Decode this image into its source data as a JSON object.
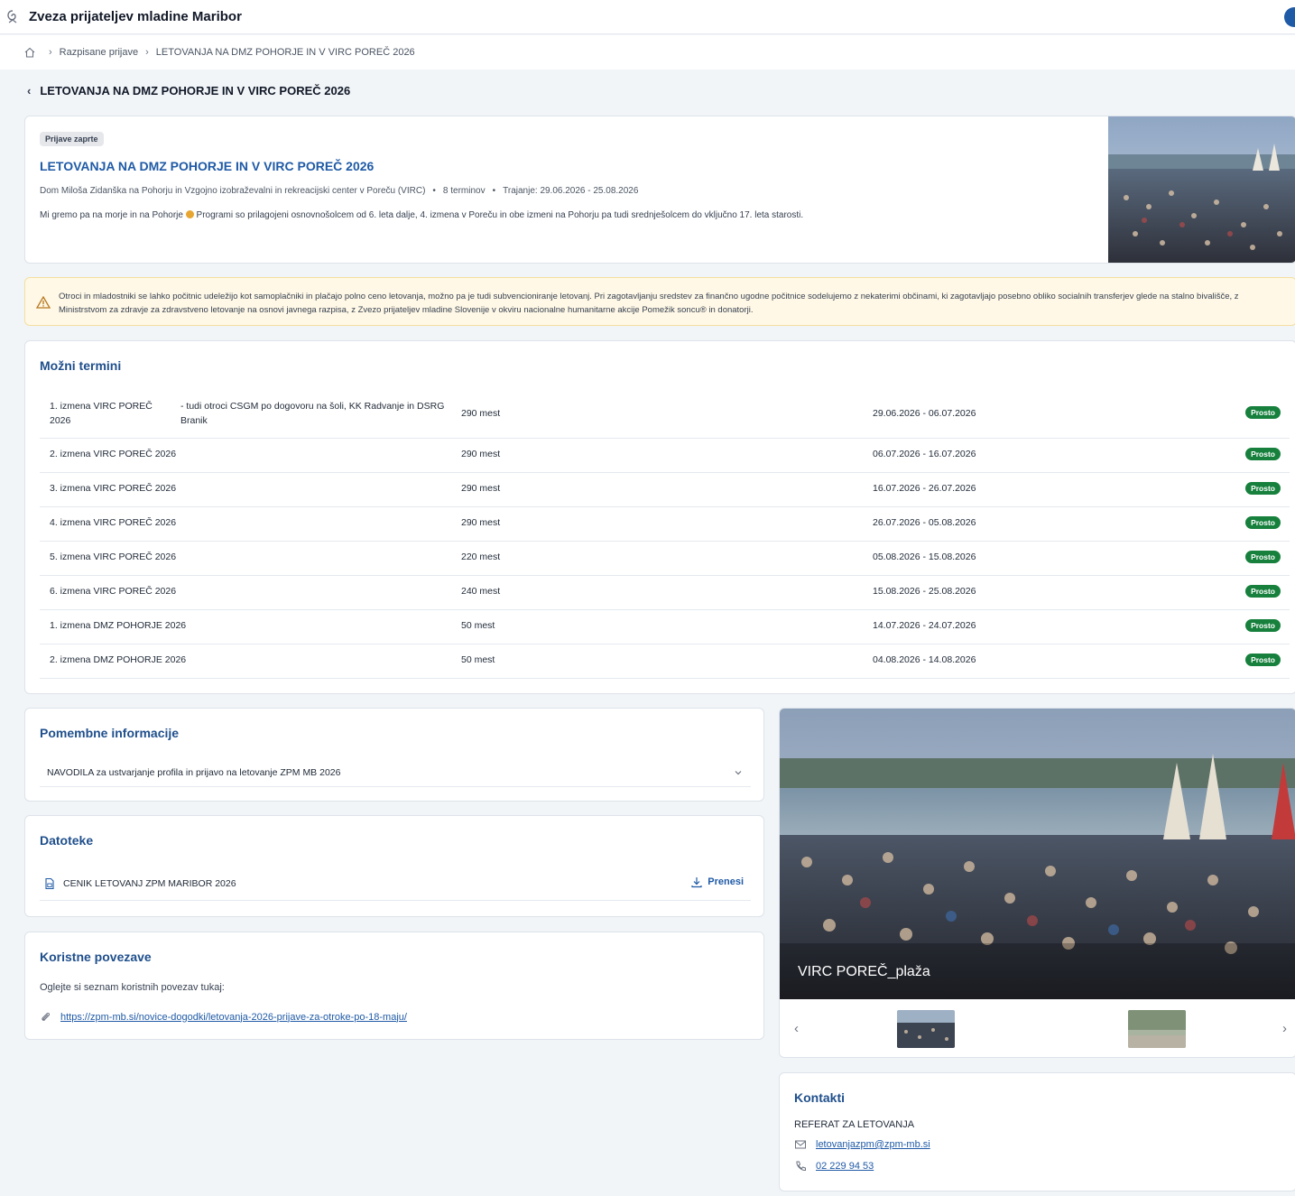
{
  "app": {
    "title": "Zveza prijateljev mladine Maribor"
  },
  "breadcrumb": {
    "items": [
      "Razpisane prijave",
      "LETOVANJA NA DMZ POHORJE IN V VIRC POREČ 2026"
    ]
  },
  "page": {
    "title": "LETOVANJA NA DMZ POHORJE IN V VIRC POREČ 2026"
  },
  "hero": {
    "badge": "Prijave zaprte",
    "title": "LETOVANJA NA DMZ POHORJE IN V VIRC POREČ 2026",
    "location": "Dom Miloša Zidanška na Pohorju in Vzgojno izobraževalni in rekreacijski center v Poreču (VIRC)",
    "terms_count": "8 terminov",
    "duration": "Trajanje: 29.06.2026 - 25.08.2026",
    "desc_before": "Mi gremo pa na morje in na Pohorje",
    "desc_after": "Programi so prilagojeni osnovnošolcem od 6. leta dalje, 4. izmena v Poreču in obe izmeni na Pohorju pa tudi srednješolcem do vključno 17. leta starosti."
  },
  "notice": {
    "text": "Otroci in mladostniki se lahko počitnic udeležijo kot samoplačniki in plačajo polno ceno letovanja, možno pa je tudi subvencioniranje letovanj. Pri zagotavljanju sredstev za finančno ugodne počitnice sodelujemo z nekaterimi občinami, ki zagotavljajo posebno obliko socialnih transferjev glede na stalno bivališče, z Ministrstvom za zdravje za zdravstveno letovanje na osnovi javnega razpisa, z Zvezo prijateljev mladine Slovenije v okviru nacionalne humanitarne akcije Pomežik soncu® in donatorji."
  },
  "terms": {
    "title": "Možni termini",
    "rows": [
      {
        "name": "1. izmena VIRC POREČ 2026",
        "note": "- tudi otroci CSGM po dogovoru na šoli, KK Radvanje in DSRG Branik",
        "places": "290 mest",
        "dates": "29.06.2026 - 06.07.2026",
        "status": "Prosto"
      },
      {
        "name": "2. izmena VIRC POREČ 2026",
        "note": "",
        "places": "290 mest",
        "dates": "06.07.2026 - 16.07.2026",
        "status": "Prosto"
      },
      {
        "name": "3. izmena VIRC POREČ 2026",
        "note": "",
        "places": "290 mest",
        "dates": "16.07.2026 - 26.07.2026",
        "status": "Prosto"
      },
      {
        "name": "4. izmena VIRC POREČ 2026",
        "note": "",
        "places": "290 mest",
        "dates": "26.07.2026 - 05.08.2026",
        "status": "Prosto"
      },
      {
        "name": "5. izmena VIRC POREČ 2026",
        "note": "",
        "places": "220 mest",
        "dates": "05.08.2026 - 15.08.2026",
        "status": "Prosto"
      },
      {
        "name": "6. izmena VIRC POREČ 2026",
        "note": "",
        "places": "240 mest",
        "dates": "15.08.2026 - 25.08.2026",
        "status": "Prosto"
      },
      {
        "name": "1. izmena DMZ POHORJE 2026",
        "note": "",
        "places": "50 mest",
        "dates": "14.07.2026 - 24.07.2026",
        "status": "Prosto"
      },
      {
        "name": "2. izmena DMZ POHORJE 2026",
        "note": "",
        "places": "50 mest",
        "dates": "04.08.2026 - 14.08.2026",
        "status": "Prosto"
      }
    ]
  },
  "info": {
    "title": "Pomembne informacije",
    "item": "NAVODILA za ustvarjanje profila in prijavo na letovanje ZPM MB 2026"
  },
  "files": {
    "title": "Datoteke",
    "file": "CENIK LETOVANJ ZPM MARIBOR 2026",
    "download": "Prenesi"
  },
  "links": {
    "title": "Koristne povezave",
    "text": "Oglejte si seznam koristnih povezav tukaj:",
    "url": "https://zpm-mb.si/novice-dogodki/letovanja-2026-prijave-za-otroke-po-18-maju/"
  },
  "gallery": {
    "caption": "VIRC POREČ_plaža",
    "prev": "‹",
    "next": "›"
  },
  "contacts": {
    "title": "Kontakti",
    "name": "REFERAT ZA LETOVANJA",
    "email": "letovanjazpm@zpm-mb.si",
    "phone": "02 229 94 53"
  },
  "colors": {
    "accent": "#1f5aa6",
    "status_free": "#16803c",
    "notice_bg": "#fff8e6"
  },
  "icons": {
    "logo": "zpm-logo-icon",
    "home": "home-icon",
    "back": "chevron-left-icon",
    "warning": "warning-icon",
    "expand": "chevron-down-icon",
    "file": "file-icon",
    "download": "download-icon",
    "link": "paperclip-icon",
    "email": "mail-icon",
    "phone": "phone-icon"
  }
}
